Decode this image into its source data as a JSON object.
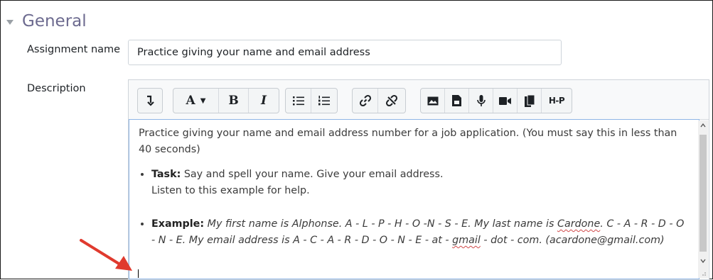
{
  "section": {
    "title": "General",
    "collapse_icon": "caret-down-icon"
  },
  "assignment_name": {
    "label": "Assignment name",
    "value": "Practice giving your name and email address"
  },
  "description": {
    "label": "Description",
    "toolbar": [
      {
        "group": 1,
        "buttons": [
          "collapse-toggle-icon"
        ]
      },
      {
        "group": 2,
        "buttons": [
          "font-style-icon",
          "bold-icon",
          "italic-icon"
        ],
        "labels": {
          "font": "A",
          "bold": "B",
          "italic": "I"
        }
      },
      {
        "group": 3,
        "buttons": [
          "unordered-list-icon",
          "ordered-list-icon"
        ]
      },
      {
        "group": 4,
        "buttons": [
          "link-icon",
          "unlink-icon"
        ]
      },
      {
        "group": 5,
        "buttons": [
          "image-icon",
          "media-file-icon",
          "record-audio-icon",
          "record-video-icon",
          "manage-files-icon",
          "h5p-icon"
        ],
        "labels": {
          "h5p": "H-P"
        }
      }
    ],
    "content": {
      "intro": "Practice giving your name and email address number for a job application.  (You must say this in less than 40 seconds)",
      "task_label": "Task:",
      "task_line1": " Say and spell your name. Give your email address.",
      "task_line2": "Listen to this example for help.",
      "example_label": "Example:",
      "example_part1": " My first name is Alphonse. A - L - P - H - O -N - S - E.  My last name is ",
      "example_cardone": "Cardone",
      "example_part2": ". C - A - R - D - O - N - E.  My email address is  A - C - A - R - D - O - N - E - at - ",
      "example_gmail": "gmail",
      "example_part3": " - dot - com. (acardone@gmail.com)"
    }
  },
  "colors": {
    "section_title": "#6c6a8f",
    "arrow": "#e03a2e",
    "editor_border": "#8fb6e6"
  }
}
